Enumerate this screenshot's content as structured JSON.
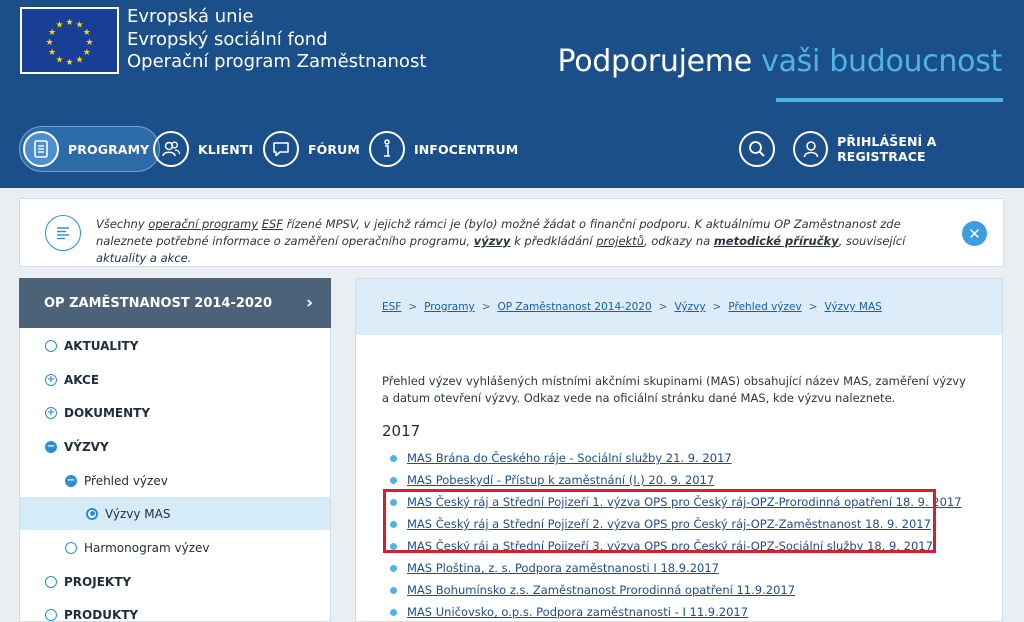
{
  "header": {
    "eu_lines": [
      "Evropská unie",
      "Evropský sociální fond",
      "Operační program Zaměstnanost"
    ],
    "slogan_main": "Podporujeme",
    "slogan_accent": "vaši budoucnost"
  },
  "nav": {
    "programy": "PROGRAMY",
    "klienti": "KLIENTI",
    "forum": "FÓRUM",
    "infocentrum": "INFOCENTRUM",
    "login": "PŘIHLÁŠENÍ A REGISTRACE",
    "icons": [
      "document-icon",
      "users-icon",
      "chat-icon",
      "info-icon",
      "search-icon",
      "user-icon"
    ]
  },
  "notice": {
    "p1": "Všechny ",
    "link1": "operační programy",
    "p2": " ",
    "link2": "ESF",
    "p3": " řízené MPSV, v jejichž rámci je (bylo) možné žádat o finanční podporu. K aktuálnímu OP Zaměstnanost zde naleznete potřebné informace o zaměření operačního programu, ",
    "b1": "výzvy",
    "p4": " k předkládání ",
    "link3": "projektů",
    "p5": ", odkazy na ",
    "b2": "metodické příručky",
    "p6": ", související aktuality a akce.",
    "close": "✕"
  },
  "sidebar": {
    "title": "OP ZAMĚSTNANOST 2014-2020",
    "chevron": "›",
    "items": [
      {
        "label": "AKTUALITY",
        "marker": ""
      },
      {
        "label": "AKCE",
        "marker": "+"
      },
      {
        "label": "DOKUMENTY",
        "marker": "+"
      },
      {
        "label": "VÝZVY",
        "marker": "−"
      },
      {
        "label": "Přehled výzev",
        "marker": "−"
      },
      {
        "label": "Výzvy MAS",
        "marker": ""
      },
      {
        "label": "Harmonogram výzev",
        "marker": ""
      },
      {
        "label": "PROJEKTY",
        "marker": ""
      },
      {
        "label": "PRODUKTY",
        "marker": ""
      }
    ]
  },
  "breadcrumb": [
    "ESF",
    "Programy",
    "OP Zaměstnanost 2014-2020",
    "Výzvy",
    "Přehled výzev",
    "Výzvy MAS"
  ],
  "breadcrumb_sep": ">",
  "intro": "Přehled výzev vyhlášených místními akčními skupinami (MAS) obsahující název MAS, zaměření výzvy a datum otevření výzvy. Odkaz vede na oficiální stránku dané MAS, kde výzvu naleznete.",
  "year": "2017",
  "links": [
    "MAS Brána do Českého ráje - Sociální služby 21. 9. 2017",
    "MAS Pobeskydí - Přístup k zaměstnání (I.) 20. 9. 2017",
    "MAS Český ráj a Střední Pojizeří 1. výzva OPS pro Český ráj-OPZ-Prorodinná opatření 18. 9. 2017",
    "MAS Český ráj a Střední Pojizeří 2. výzva OPS pro Český ráj-OPZ-Zaměstnanost 18. 9. 2017",
    "MAS Český ráj a Střední Pojizeří 3. výzva OPS pro Český ráj-OPZ-Sociální služby 18. 9. 2017",
    "MAS Ploština, z. s. Podpora zaměstnanosti I 18.9.2017",
    "MAS Bohumínsko z.s. Zaměstnanost Prorodinná opatření 11.9.2017",
    "MAS Uničovsko, o.p.s. Podpora zaměstnanosti - I 11.9.2017"
  ],
  "colors": {
    "header_bg": "#1b4f8a",
    "accent": "#4fb3ea",
    "highlight_border": "#d7202e",
    "sidebar_head": "#4c6279"
  }
}
